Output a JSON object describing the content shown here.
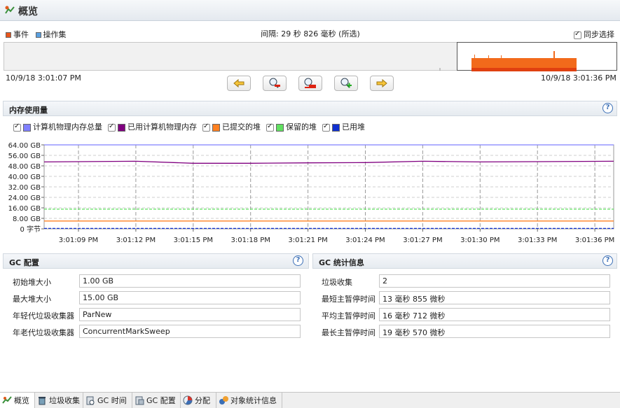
{
  "header": {
    "title": "概览"
  },
  "timeline": {
    "legend_events": "事件",
    "legend_opsets": "操作集",
    "interval_text": "间隔: 29 秒 826 毫秒 (所选)",
    "sync_label": "同步选择",
    "start_time": "10/9/18 3:01:07 PM",
    "end_time": "10/9/18 3:01:36 PM",
    "colors": {
      "events": "#e8551c",
      "opsets": "#5aa0e0",
      "bars": "#f26a1b"
    }
  },
  "memory": {
    "title": "内存使用量",
    "legend": [
      {
        "label": "计算机物理内存总量",
        "color": "#8080ff"
      },
      {
        "label": "已用计算机物理内存",
        "color": "#800080"
      },
      {
        "label": "已提交的堆",
        "color": "#ff8020"
      },
      {
        "label": "保留的堆",
        "color": "#60e060"
      },
      {
        "label": "已用堆",
        "color": "#1030d0"
      }
    ]
  },
  "chart_data": {
    "type": "line",
    "y_tick_labels": [
      "64.00 GB",
      "56.00 GB",
      "48.00 GB",
      "40.00 GB",
      "32.00 GB",
      "24.00 GB",
      "16.00 GB",
      "8.00 GB",
      "0 字节"
    ],
    "x_tick_labels": [
      "3:01:09 PM",
      "3:01:12 PM",
      "3:01:15 PM",
      "3:01:18 PM",
      "3:01:21 PM",
      "3:01:24 PM",
      "3:01:27 PM",
      "3:01:30 PM",
      "3:01:33 PM",
      "3:01:36 PM"
    ],
    "ylim": [
      0,
      64
    ],
    "grid": true,
    "series": [
      {
        "name": "计算机物理内存总量",
        "values": [
          64,
          64,
          64,
          64,
          64,
          64,
          64,
          64,
          64,
          64
        ]
      },
      {
        "name": "已用计算机物理内存",
        "values": [
          51,
          51.5,
          50,
          50,
          50.3,
          50.5,
          51.5,
          51,
          51.2,
          51.5
        ]
      },
      {
        "name": "已提交的堆",
        "values": [
          6,
          6,
          6,
          6,
          6,
          6,
          6,
          6,
          6,
          6
        ]
      },
      {
        "name": "保留的堆",
        "values": [
          15,
          15,
          15,
          15,
          15,
          15,
          15,
          15,
          15,
          15
        ]
      },
      {
        "name": "已用堆",
        "values": [
          0.3,
          0.3,
          0.3,
          0.3,
          0.3,
          0.3,
          0.3,
          0.3,
          0.3,
          0.3
        ]
      }
    ]
  },
  "gc_config": {
    "title": "GC 配置",
    "rows": [
      {
        "label": "初始堆大小",
        "value": "1.00 GB"
      },
      {
        "label": "最大堆大小",
        "value": "15.00 GB"
      },
      {
        "label": "年轻代垃圾收集器",
        "value": "ParNew"
      },
      {
        "label": "年老代垃圾收集器",
        "value": "ConcurrentMarkSweep"
      }
    ]
  },
  "gc_stats": {
    "title": "GC 统计信息",
    "rows": [
      {
        "label": "垃圾收集",
        "value": "2"
      },
      {
        "label": "最短主暂停时间",
        "value": "13 毫秒 855 微秒"
      },
      {
        "label": "平均主暂停时间",
        "value": "16 毫秒 712 微秒"
      },
      {
        "label": "最长主暂停时间",
        "value": "19 毫秒 570 微秒"
      }
    ]
  },
  "tabs": [
    {
      "label": "概览",
      "icon": "overview-icon"
    },
    {
      "label": "垃圾收集",
      "icon": "trash-icon"
    },
    {
      "label": "GC 时间",
      "icon": "gc-time-icon"
    },
    {
      "label": "GC 配置",
      "icon": "gc-config-icon"
    },
    {
      "label": "分配",
      "icon": "allocation-icon"
    },
    {
      "label": "对象统计信息",
      "icon": "object-stats-icon"
    }
  ]
}
